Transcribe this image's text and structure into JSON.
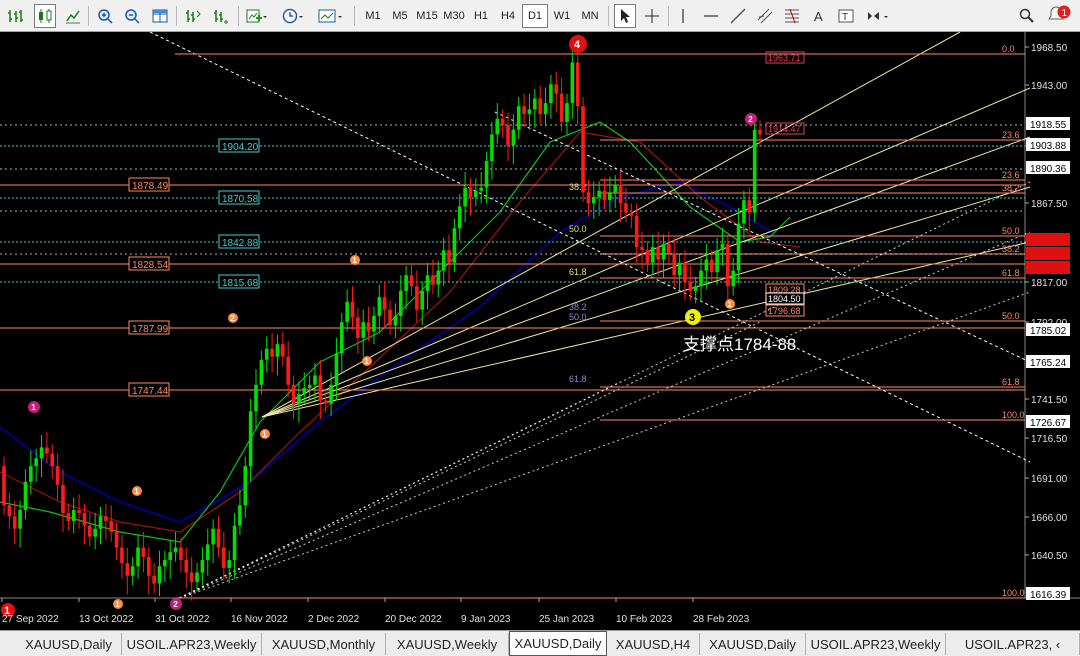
{
  "toolbar": {
    "timeframes": [
      "M1",
      "M5",
      "M15",
      "M30",
      "H1",
      "H4",
      "D1",
      "W1",
      "MN"
    ],
    "active_timeframe": "D1",
    "notification_count": "1"
  },
  "chart": {
    "symbol": "XAUUSD",
    "timeframe": "Daily",
    "price_axis": [
      "1968.50",
      "1943.00",
      "1918.55",
      "1903.88",
      "1890.36",
      "1867.50",
      "1842.50",
      "1817.00",
      "1792.00",
      "1785.02",
      "1765.24",
      "1741.50",
      "1726.67",
      "1716.50",
      "1691.00",
      "1666.00",
      "1640.50",
      "1616.39"
    ],
    "date_axis": [
      "27 Sep 2022",
      "13 Oct 2022",
      "31 Oct 2022",
      "16 Nov 2022",
      "2 Dec 2022",
      "20 Dec 2022",
      "9 Jan 2023",
      "25 Jan 2023",
      "10 Feb 2023",
      "28 Feb 2023"
    ],
    "h_levels": [
      "1904.20",
      "1878.49",
      "1870.58",
      "1842.88",
      "1828.54",
      "1815.68",
      "1787.99",
      "1747.44"
    ],
    "fib_right": [
      "0.0",
      "23.6",
      "23.6",
      "38.2",
      "50.0",
      "38.2",
      "61.8",
      "50.0",
      "61.8",
      "100.0",
      "100.0"
    ],
    "fib_mid": [
      "38.2",
      "50.0",
      "61.8",
      "38.2",
      "50.0",
      "61.8"
    ],
    "price_tags": [
      "1963.71",
      "1914.47",
      "1809.28",
      "1804.50",
      "1796.68"
    ],
    "wave_labels": [
      "4",
      "2",
      "3",
      "1",
      "2",
      "1",
      "1",
      "1",
      "1",
      "1",
      "1",
      "1",
      "2"
    ],
    "annotation": "支撑点1784-88"
  },
  "tabs": [
    "XAUUSD,Daily",
    "USOIL.APR23,Weekly",
    "XAUUSD,Monthly",
    "XAUUSD,Weekly",
    "XAUUSD,Daily",
    "XAUUSD,H4",
    "XAUUSD,Daily",
    "USOIL.APR23,Weekly",
    "USOIL.APR23, ‹"
  ],
  "active_tab": 4,
  "colors": {
    "bull": "#00e000",
    "bear": "#ff1a1a",
    "fib": "#ff8a65",
    "dotted": "#ffffff",
    "wave_red": "#ff1a1a",
    "wave_magenta": "#c0207a",
    "wave_orange": "#ff8a40",
    "wave_yellow": "#f0f000"
  },
  "chart_data": {
    "type": "candlestick",
    "symbol": "XAUUSD",
    "timeframe": "Daily",
    "ylim": [
      1610,
      1975
    ],
    "bias_start": 1700,
    "x_labels": [
      "27 Sep 2022",
      "13 Oct 2022",
      "31 Oct 2022",
      "16 Nov 2022",
      "2 Dec 2022",
      "20 Dec 2022",
      "9 Jan 2023",
      "25 Jan 2023",
      "10 Feb 2023",
      "28 Feb 2023"
    ],
    "ohlc_close": [
      1675,
      1668,
      1660,
      1672,
      1690,
      1700,
      1705,
      1712,
      1708,
      1700,
      1688,
      1670,
      1665,
      1672,
      1670,
      1662,
      1655,
      1660,
      1668,
      1665,
      1658,
      1648,
      1638,
      1630,
      1636,
      1648,
      1642,
      1630,
      1625,
      1636,
      1640,
      1645,
      1648,
      1640,
      1632,
      1626,
      1632,
      1640,
      1650,
      1660,
      1648,
      1635,
      1640,
      1662,
      1675,
      1700,
      1735,
      1752,
      1768,
      1775,
      1770,
      1778,
      1770,
      1752,
      1740,
      1746,
      1750,
      1752,
      1758,
      1742,
      1740,
      1752,
      1772,
      1792,
      1805,
      1795,
      1782,
      1792,
      1786,
      1796,
      1808,
      1800,
      1790,
      1796,
      1812,
      1822,
      1815,
      1800,
      1812,
      1822,
      1816,
      1825,
      1838,
      1830,
      1852,
      1866,
      1878,
      1872,
      1876,
      1878,
      1895,
      1912,
      1922,
      1918,
      1905,
      1915,
      1930,
      1925,
      1928,
      1935,
      1925,
      1932,
      1944,
      1938,
      1920,
      1932,
      1958,
      1930,
      1875,
      1868,
      1872,
      1876,
      1870,
      1875,
      1880,
      1868,
      1862,
      1860,
      1840,
      1838,
      1830,
      1840,
      1832,
      1842,
      1836,
      1822,
      1830,
      1818,
      1812,
      1815,
      1825,
      1832,
      1824,
      1838,
      1842,
      1815,
      1825,
      1855,
      1870,
      1862,
      1915,
      1912
    ]
  }
}
